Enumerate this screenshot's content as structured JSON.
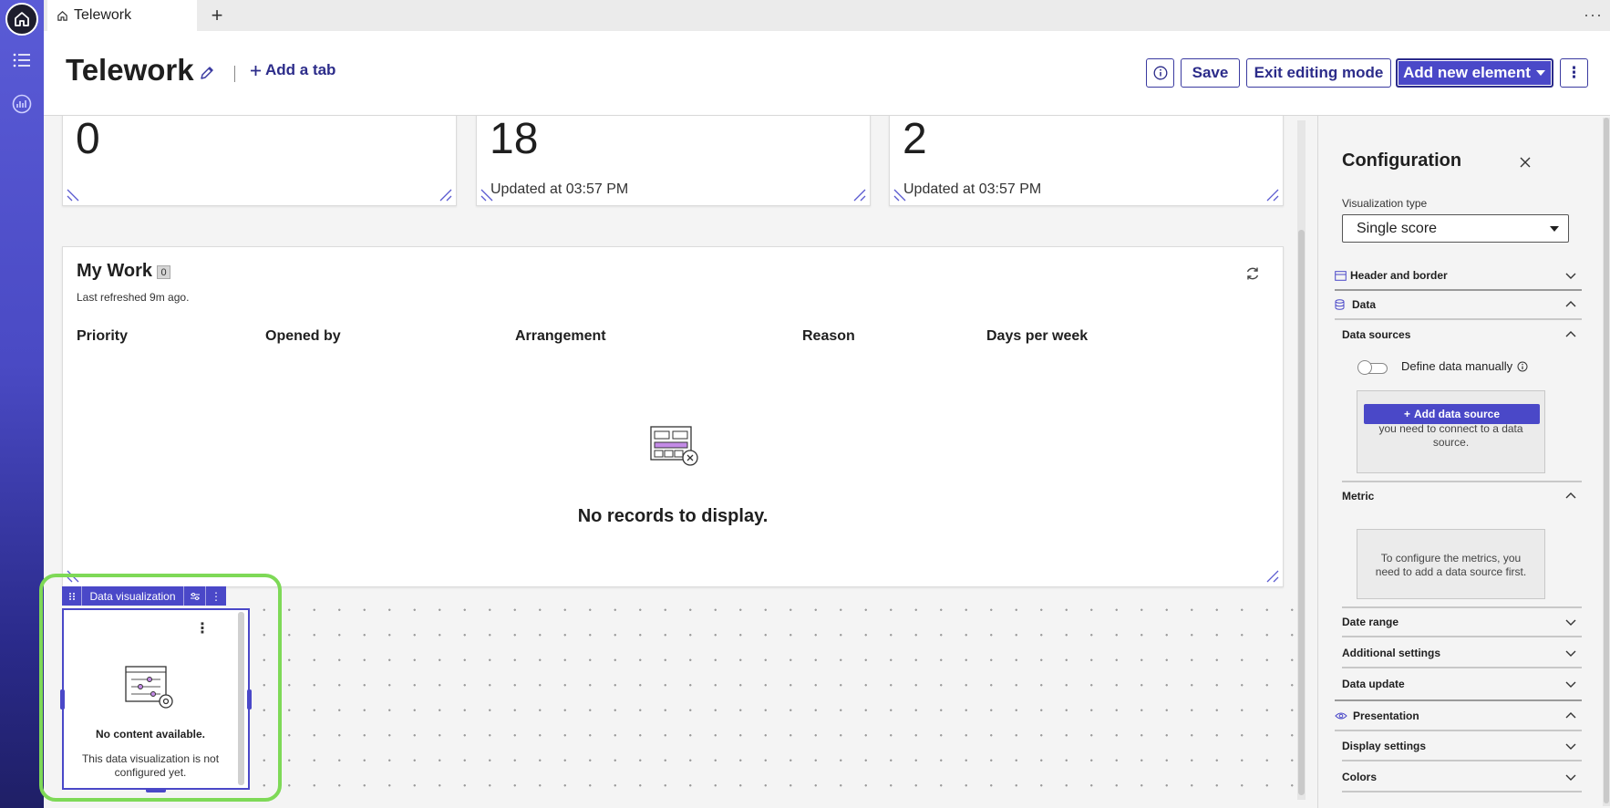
{
  "browser_tab": {
    "title": "Telework",
    "add_label": "+",
    "more_label": "···"
  },
  "header": {
    "title": "Telework",
    "add_tab_label": "Add a tab",
    "save_label": "Save",
    "exit_label": "Exit editing mode",
    "add_element_label": "Add new element",
    "more_label": "⋮"
  },
  "score_cards": [
    {
      "value": "0",
      "updated": ""
    },
    {
      "value": "18",
      "updated": "Updated at 03:57 PM"
    },
    {
      "value": "2",
      "updated": "Updated at 03:57 PM"
    }
  ],
  "my_work": {
    "title": "My Work",
    "count": "0",
    "last_refreshed": "Last refreshed 9m ago.",
    "columns": [
      "Priority",
      "Opened by",
      "Arrangement",
      "Reason",
      "Days per week"
    ],
    "empty_message": "No records to display."
  },
  "data_viz": {
    "toolbar_label": "Data visualization",
    "more_label": "⋮",
    "empty_title": "No content available.",
    "empty_text": "This data visualization is not configured yet."
  },
  "config": {
    "title": "Configuration",
    "viz_type_label": "Visualization type",
    "viz_type_value": "Single score",
    "sections": {
      "header_border": "Header and border",
      "data": "Data",
      "data_sources": "Data sources",
      "metric": "Metric",
      "date_range": "Date range",
      "additional_settings": "Additional settings",
      "data_update": "Data update",
      "presentation": "Presentation",
      "display_settings": "Display settings",
      "colors": "Colors"
    },
    "define_manually_label": "Define data manually",
    "data_source_hint": "To start configuring your chart, you need to connect to a data source.",
    "add_data_source_label": "Add data source",
    "metric_hint": "To configure the metrics, you need to add a data source first."
  },
  "colors": {
    "accent": "#4a48c8",
    "highlight": "#7ed957"
  }
}
